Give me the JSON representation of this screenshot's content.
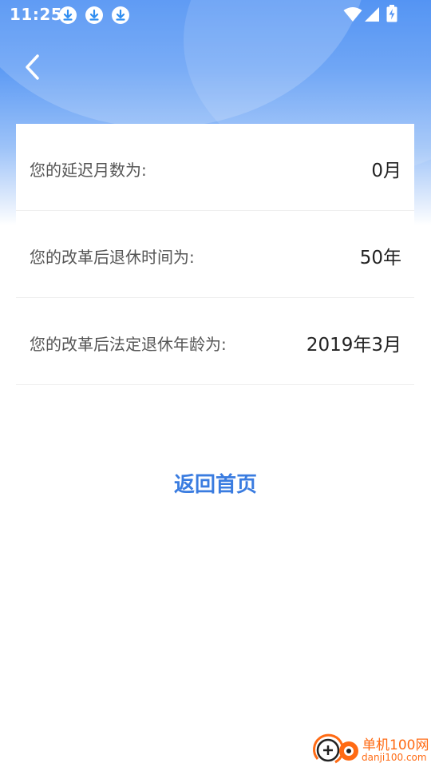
{
  "status_bar": {
    "time": "11:25",
    "download_icons": [
      "download-icon",
      "download-icon",
      "download-icon"
    ],
    "system_icons": [
      "wifi-icon",
      "signal-icon",
      "battery-charging-icon"
    ]
  },
  "header": {
    "back_icon": "chevron-left-icon"
  },
  "results": [
    {
      "label": "您的延迟月数为:",
      "value": "0月"
    },
    {
      "label": "您的改革后退休时间为:",
      "value": "50年"
    },
    {
      "label": "您的改革后法定退休年龄为:",
      "value": "2019年3月"
    }
  ],
  "actions": {
    "home_label": "返回首页"
  },
  "watermark": {
    "title": "单机100网",
    "subtitle": "danji100.com"
  },
  "colors": {
    "header_blue": "#3d86f2",
    "link_blue": "#3a7ce0",
    "watermark_orange": "#ff6a13"
  }
}
